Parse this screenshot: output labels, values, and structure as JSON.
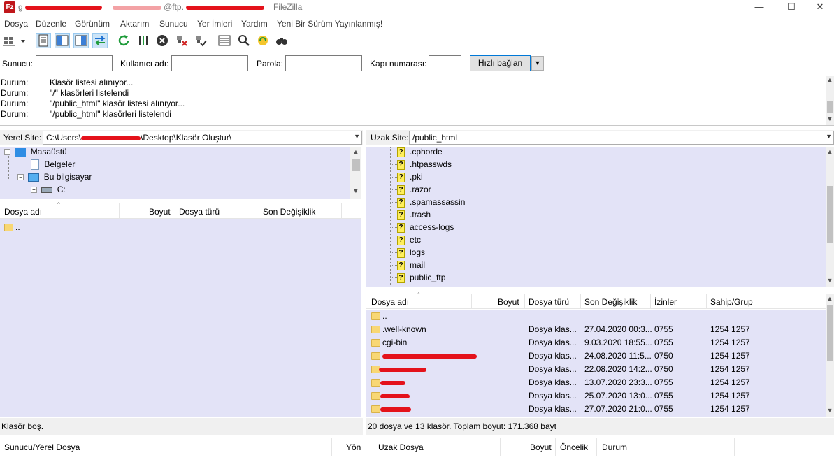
{
  "window": {
    "title_prefix": "g",
    "title_mid": "@ftp.",
    "title_suffix": "FileZilla",
    "app_icon": "Fz",
    "minimize": "—",
    "maximize": "☐",
    "close": "✕"
  },
  "menu": [
    "Dosya",
    "Düzenle",
    "Görünüm",
    "Aktarım",
    "Sunucu",
    "Yer İmleri",
    "Yardım",
    "Yeni Bir Sürüm Yayınlanmış!"
  ],
  "toolbar_icons": [
    "site-manager-icon",
    "dropdown-icon",
    "toggle-log-icon",
    "toggle-local-tree-icon",
    "toggle-remote-tree-icon",
    "toggle-queue-icon",
    "refresh-icon",
    "process-queue-icon",
    "cancel-icon",
    "disconnect-icon",
    "reconnect-icon",
    "filter-icon",
    "compare-icon",
    "sync-browse-icon",
    "search-icon"
  ],
  "quickconnect": {
    "host_label": "Sunucu:",
    "user_label": "Kullanıcı adı:",
    "pass_label": "Parola:",
    "port_label": "Kapı numarası:",
    "connect_label": "Hızlı bağlan",
    "dropdown": "▼"
  },
  "log": [
    {
      "key": "Durum:",
      "msg": "Klasör listesi alınıyor..."
    },
    {
      "key": "Durum:",
      "msg": "\"/\" klasörleri listelendi"
    },
    {
      "key": "Durum:",
      "msg": "\"/public_html\" klasör listesi alınıyor..."
    },
    {
      "key": "Durum:",
      "msg": "\"/public_html\" klasörleri listelendi"
    }
  ],
  "local": {
    "site_label": "Yerel Site:",
    "path_prefix": "C:\\Users\\",
    "path_suffix": "\\Desktop\\Klasör Oluştur\\",
    "tree": [
      {
        "label": "Masaüstü",
        "expander": "−"
      },
      {
        "label": "Belgeler"
      },
      {
        "label": "Bu bilgisayar",
        "expander": "−"
      },
      {
        "label": "C:",
        "expander": "+"
      }
    ],
    "columns": [
      "Dosya adı",
      "Boyut",
      "Dosya türü",
      "Son Değişiklik"
    ],
    "files": [
      ".."
    ],
    "status": "Klasör boş."
  },
  "remote": {
    "site_label": "Uzak Site:",
    "path": "/public_html",
    "tree": [
      ".cphorde",
      ".htpasswds",
      ".pki",
      ".razor",
      ".spamassassin",
      ".trash",
      "access-logs",
      "etc",
      "logs",
      "mail",
      "public_ftp"
    ],
    "columns": [
      "Dosya adı",
      "Boyut",
      "Dosya türü",
      "Son Değişiklik",
      "İzinler",
      "Sahip/Grup"
    ],
    "files": [
      {
        "name": "..",
        "type": "",
        "modified": "",
        "perm": "",
        "owner": ""
      },
      {
        "name": ".well-known",
        "type": "Dosya klas...",
        "modified": "27.04.2020 00:3...",
        "perm": "0755",
        "owner": "1254 1257"
      },
      {
        "name": "cgi-bin",
        "type": "Dosya klas...",
        "modified": "9.03.2020 18:55...",
        "perm": "0755",
        "owner": "1254 1257"
      },
      {
        "name": "",
        "type": "Dosya klas...",
        "modified": "24.08.2020 11:5...",
        "perm": "0750",
        "owner": "1254 1257"
      },
      {
        "name": "",
        "type": "Dosya klas...",
        "modified": "22.08.2020 14:2...",
        "perm": "0750",
        "owner": "1254 1257"
      },
      {
        "name": "",
        "type": "Dosya klas...",
        "modified": "13.07.2020 23:3...",
        "perm": "0755",
        "owner": "1254 1257"
      },
      {
        "name": "",
        "type": "Dosya klas...",
        "modified": "25.07.2020 13:0...",
        "perm": "0755",
        "owner": "1254 1257"
      },
      {
        "name": "",
        "type": "Dosya klas...",
        "modified": "27.07.2020 21:0...",
        "perm": "0755",
        "owner": "1254 1257"
      }
    ],
    "status": "20 dosya ve 13 klasör. Toplam boyut: 171.368 bayt"
  },
  "queue": {
    "columns": [
      "Sunucu/Yerel Dosya",
      "Yön",
      "Uzak Dosya",
      "Boyut",
      "Öncelik",
      "Durum"
    ]
  },
  "colors": {
    "panel": "#e3e3f7",
    "redaction": "#e4121b",
    "folder": "#f8d775"
  }
}
